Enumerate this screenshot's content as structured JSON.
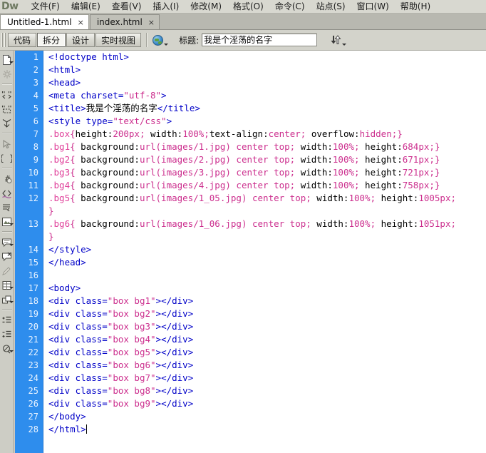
{
  "app": {
    "logo": "Dw",
    "menu": [
      {
        "label": "文件(F)",
        "name": "menu-file"
      },
      {
        "label": "编辑(E)",
        "name": "menu-edit"
      },
      {
        "label": "查看(V)",
        "name": "menu-view"
      },
      {
        "label": "插入(I)",
        "name": "menu-insert"
      },
      {
        "label": "修改(M)",
        "name": "menu-modify"
      },
      {
        "label": "格式(O)",
        "name": "menu-format"
      },
      {
        "label": "命令(C)",
        "name": "menu-commands"
      },
      {
        "label": "站点(S)",
        "name": "menu-site"
      },
      {
        "label": "窗口(W)",
        "name": "menu-window"
      },
      {
        "label": "帮助(H)",
        "name": "menu-help"
      }
    ]
  },
  "tabs": [
    {
      "label": "Untitled-1.html",
      "close": "×",
      "active": true
    },
    {
      "label": "index.html",
      "close": "×",
      "active": false
    }
  ],
  "toolbar": {
    "view_buttons": [
      {
        "label": "代码",
        "active": false
      },
      {
        "label": "拆分",
        "active": true
      },
      {
        "label": "设计",
        "active": false
      },
      {
        "label": "实时视图",
        "active": false
      }
    ],
    "globe_icon": "globe-icon",
    "title_label": "标题:",
    "title_value": "我是个淫荡的名字",
    "title_placeholder": "",
    "file_management_icon": "up-down-arrows-icon"
  },
  "rail": {
    "icons": [
      "new-document-icon",
      "snippet-icon",
      "open-tag-icon",
      "wrap-tag-icon",
      "collapse-selection-icon",
      "collapse-outside-icon",
      "expand-all-icon",
      "format-source-icon",
      "indent-comment-icon",
      "apply-comment-icon",
      "highlight-invalid-icon",
      "apply-comment-2-icon",
      "remove-comment-icon",
      "wrap-tag-2-icon",
      "recent-snippets-icon",
      "move-css-icon",
      "indent-code-icon",
      "outdent-code-icon",
      "format-source-code-icon"
    ]
  },
  "editor": {
    "line_numbers": [
      "1",
      "2",
      "3",
      "4",
      "5",
      "6",
      "7",
      "8",
      "9",
      "10",
      "11",
      "12",
      "",
      "13",
      "",
      "14",
      "15",
      "16",
      "17",
      "18",
      "19",
      "20",
      "21",
      "22",
      "23",
      "24",
      "25",
      "26",
      "27",
      "28"
    ],
    "lines": [
      {
        "n": "1",
        "text": "<!doctype html>"
      },
      {
        "n": "2",
        "text": "<html>"
      },
      {
        "n": "3",
        "text": "<head>"
      },
      {
        "n": "4",
        "text": "<meta charset=\"utf-8\">"
      },
      {
        "n": "5",
        "text": "<title>我是个淫荡的名字</title>"
      },
      {
        "n": "6",
        "text": "<style type=\"text/css\">"
      },
      {
        "n": "7",
        "text": ".box{height:200px; width:100%;text-align:center; overflow:hidden;}"
      },
      {
        "n": "8",
        "text": ".bg1{ background:url(images/1.jpg) center top; width:100%; height:684px;}"
      },
      {
        "n": "9",
        "text": ".bg2{ background:url(images/2.jpg) center top; width:100%; height:671px;}"
      },
      {
        "n": "10",
        "text": ".bg3{ background:url(images/3.jpg) center top; width:100%; height:721px;}"
      },
      {
        "n": "11",
        "text": ".bg4{ background:url(images/4.jpg) center top; width:100%; height:758px;}"
      },
      {
        "n": "12",
        "text": ".bg5{ background:url(images/1_05.jpg) center top; width:100%; height:1005px;"
      },
      {
        "n": "",
        "text": "}"
      },
      {
        "n": "13",
        "text": ".bg6{ background:url(images/1_06.jpg) center top; width:100%; height:1051px;"
      },
      {
        "n": "",
        "text": "}"
      },
      {
        "n": "14",
        "text": "</style>"
      },
      {
        "n": "15",
        "text": "</head>"
      },
      {
        "n": "16",
        "text": ""
      },
      {
        "n": "17",
        "text": "<body>"
      },
      {
        "n": "18",
        "text": "<div class=\"box bg1\"></div>"
      },
      {
        "n": "19",
        "text": "<div class=\"box bg2\"></div>"
      },
      {
        "n": "20",
        "text": "<div class=\"box bg3\"></div>"
      },
      {
        "n": "21",
        "text": "<div class=\"box bg4\"></div>"
      },
      {
        "n": "22",
        "text": "<div class=\"box bg5\"></div>"
      },
      {
        "n": "23",
        "text": "<div class=\"box bg6\"></div>"
      },
      {
        "n": "24",
        "text": "<div class=\"box bg7\"></div>"
      },
      {
        "n": "25",
        "text": "<div class=\"box bg8\"></div>"
      },
      {
        "n": "26",
        "text": "<div class=\"box bg9\"></div>"
      },
      {
        "n": "27",
        "text": "</body>"
      },
      {
        "n": "28",
        "text": "</html>"
      }
    ]
  },
  "colors": {
    "gutter_bg": "#2e8ded",
    "gutter_fg": "#e9f3ff",
    "tag": "#0000c8",
    "attr_value": "#cc2f8e",
    "selector": "#e0409a",
    "chrome_bg": "#d3d3cb",
    "editor_bg": "#ffffff"
  }
}
